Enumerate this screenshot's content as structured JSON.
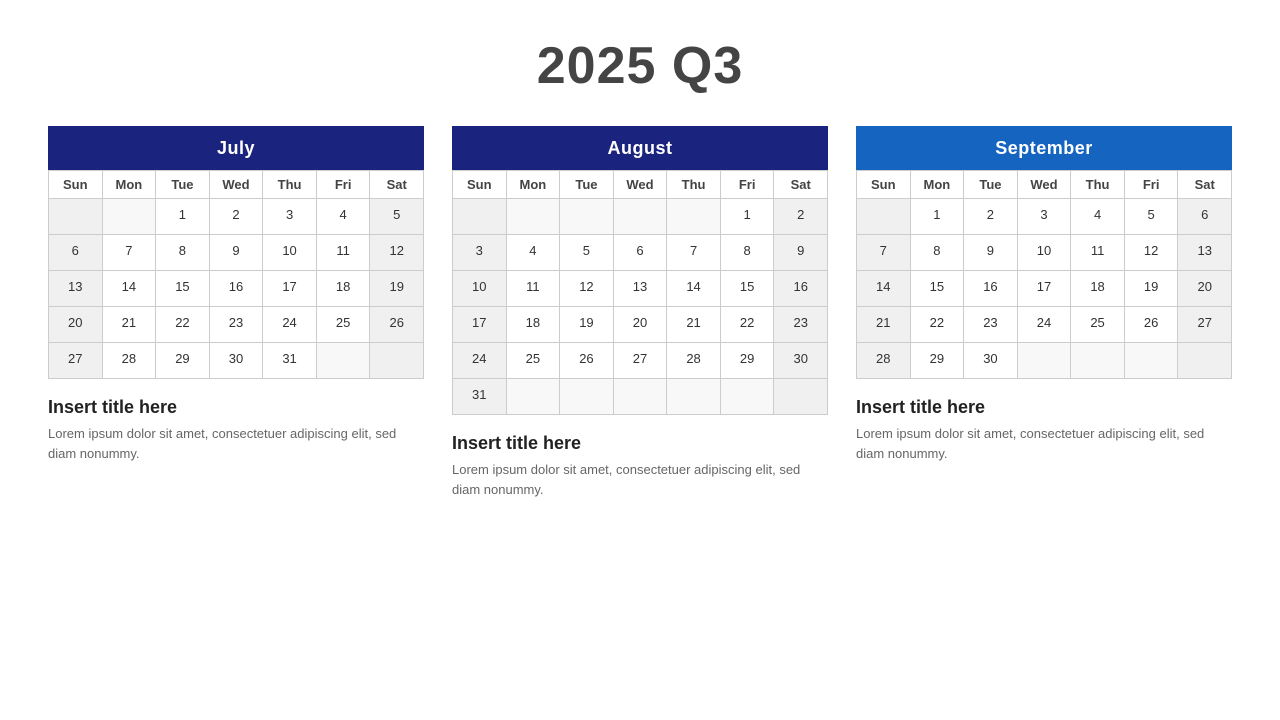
{
  "title": "2025 Q3",
  "months": [
    {
      "name": "July",
      "headerClass": "july",
      "days": [
        "Sun",
        "Mon",
        "Tue",
        "Wed",
        "Thu",
        "Fri",
        "Sat"
      ],
      "startOffset": 2,
      "totalDays": 31,
      "section": {
        "title": "Insert title here",
        "body": "Lorem ipsum dolor sit amet, consectetuer adipiscing elit, sed diam nonummy."
      }
    },
    {
      "name": "August",
      "headerClass": "august",
      "days": [
        "Sun",
        "Mon",
        "Tue",
        "Wed",
        "Thu",
        "Fri",
        "Sat"
      ],
      "startOffset": 5,
      "totalDays": 31,
      "section": {
        "title": "Insert title here",
        "body": "Lorem ipsum dolor sit amet, consectetuer adipiscing elit, sed diam nonummy."
      }
    },
    {
      "name": "September",
      "headerClass": "september",
      "days": [
        "Sun",
        "Mon",
        "Tue",
        "Wed",
        "Thu",
        "Fri",
        "Sat"
      ],
      "startOffset": 1,
      "totalDays": 30,
      "section": {
        "title": "Insert title here",
        "body": "Lorem ipsum dolor sit amet, consectetuer adipiscing elit, sed diam nonummy."
      }
    }
  ]
}
